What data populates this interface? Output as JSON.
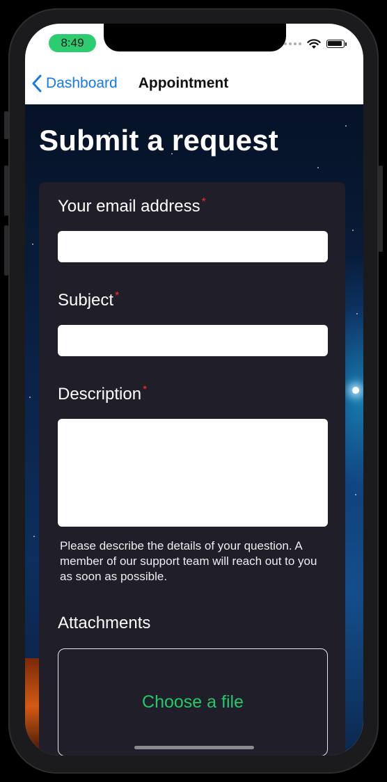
{
  "status_bar": {
    "time": "8:49"
  },
  "nav": {
    "back_label": "Dashboard",
    "title": "Appointment"
  },
  "page": {
    "title": "Submit a request"
  },
  "form": {
    "email_label": "Your email address",
    "subject_label": "Subject",
    "description_label": "Description",
    "required_marker": "*",
    "description_help": "Please describe the details of your question. A member of our support team will reach out to you as soon as possible.",
    "attachments_label": "Attachments",
    "choose_file_label": "Choose a file",
    "email_value": "",
    "subject_value": "",
    "description_value": ""
  },
  "colors": {
    "accent_blue": "#1479f0",
    "accent_green": "#23c86b",
    "required_red": "#ff2a2a",
    "card_bg": "#1f1e29"
  },
  "icons": [
    "chevron-left-icon",
    "cellular-signal-icon",
    "wifi-icon",
    "battery-icon"
  ]
}
